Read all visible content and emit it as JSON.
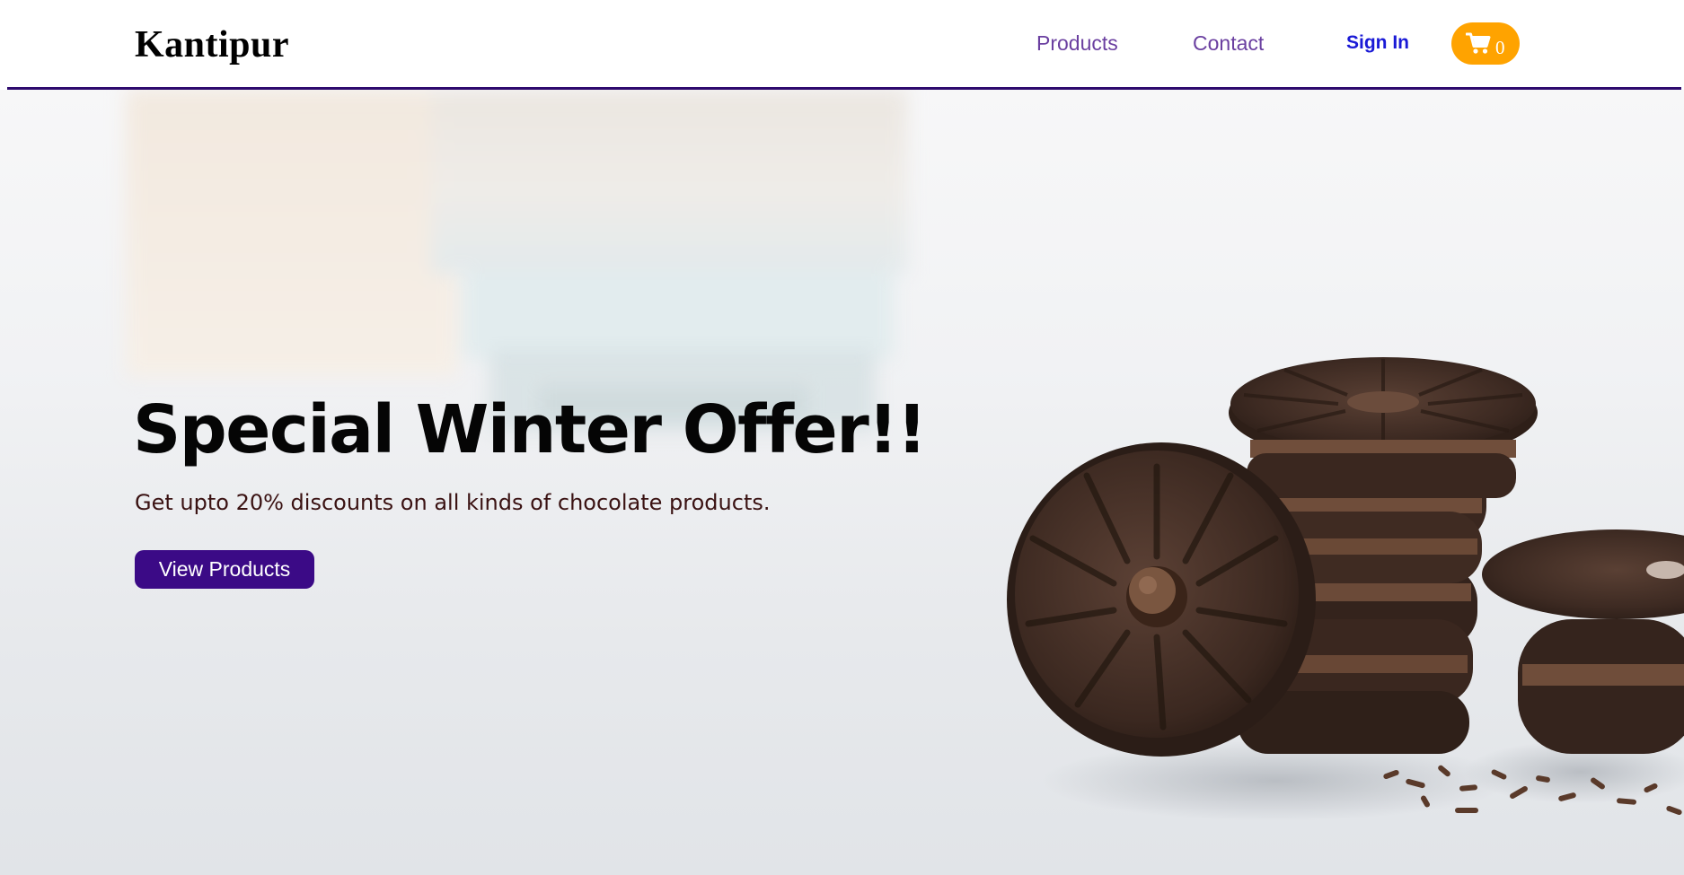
{
  "header": {
    "brand": "Kantipur",
    "nav": {
      "products": "Products",
      "contact": "Contact"
    },
    "sign_in": "Sign In",
    "cart": {
      "icon": "shopping-cart-icon",
      "count": "0"
    }
  },
  "hero": {
    "title": "Special Winter Offer!!",
    "subtitle": "Get upto 20% discounts on all kinds of chocolate products.",
    "cta_label": "View Products"
  },
  "colors": {
    "header_rule": "#2e0a6e",
    "nav_link": "#6a3fa0",
    "sign_in": "#1a1ad6",
    "cart_button": "#ffa300",
    "cta_button": "#3b0a86"
  }
}
